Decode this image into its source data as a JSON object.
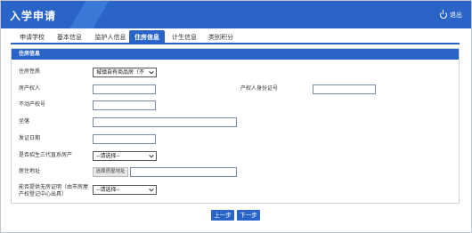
{
  "header": {
    "title": "入学申请",
    "exit_label": "退出"
  },
  "tabs": [
    {
      "label": "申请学校",
      "active": false
    },
    {
      "label": "基本信息",
      "active": false
    },
    {
      "label": "监护人信息",
      "active": false
    },
    {
      "label": "住房信息",
      "active": true
    },
    {
      "label": "计生信息",
      "active": false
    },
    {
      "label": "类别积分",
      "active": false
    }
  ],
  "section": {
    "title": "住房信息"
  },
  "form": {
    "housing_type": {
      "label": "住房性质",
      "value": "城镇自有商品房（不"
    },
    "owner": {
      "label": "房产权人",
      "value": ""
    },
    "owner_id": {
      "label": "产权人身份证号",
      "value": ""
    },
    "cert_no": {
      "label": "不动产权号",
      "value": ""
    },
    "location": {
      "label": "坐落",
      "value": ""
    },
    "issue_date": {
      "label": "发证日期",
      "value": ""
    },
    "direct_relative": {
      "label": "是否招生三代直系房产",
      "value": "--请选择--"
    },
    "address": {
      "label": "居住地址",
      "button": "选择房屋地址",
      "value": ""
    },
    "no_house_cert": {
      "label": "能否提供无房证明（由市房屋产权登记中心出具）",
      "value": "--请选择--"
    }
  },
  "buttons": {
    "prev": "上一步",
    "next": "下一步"
  },
  "colors": {
    "primary": "#2a64c8"
  }
}
